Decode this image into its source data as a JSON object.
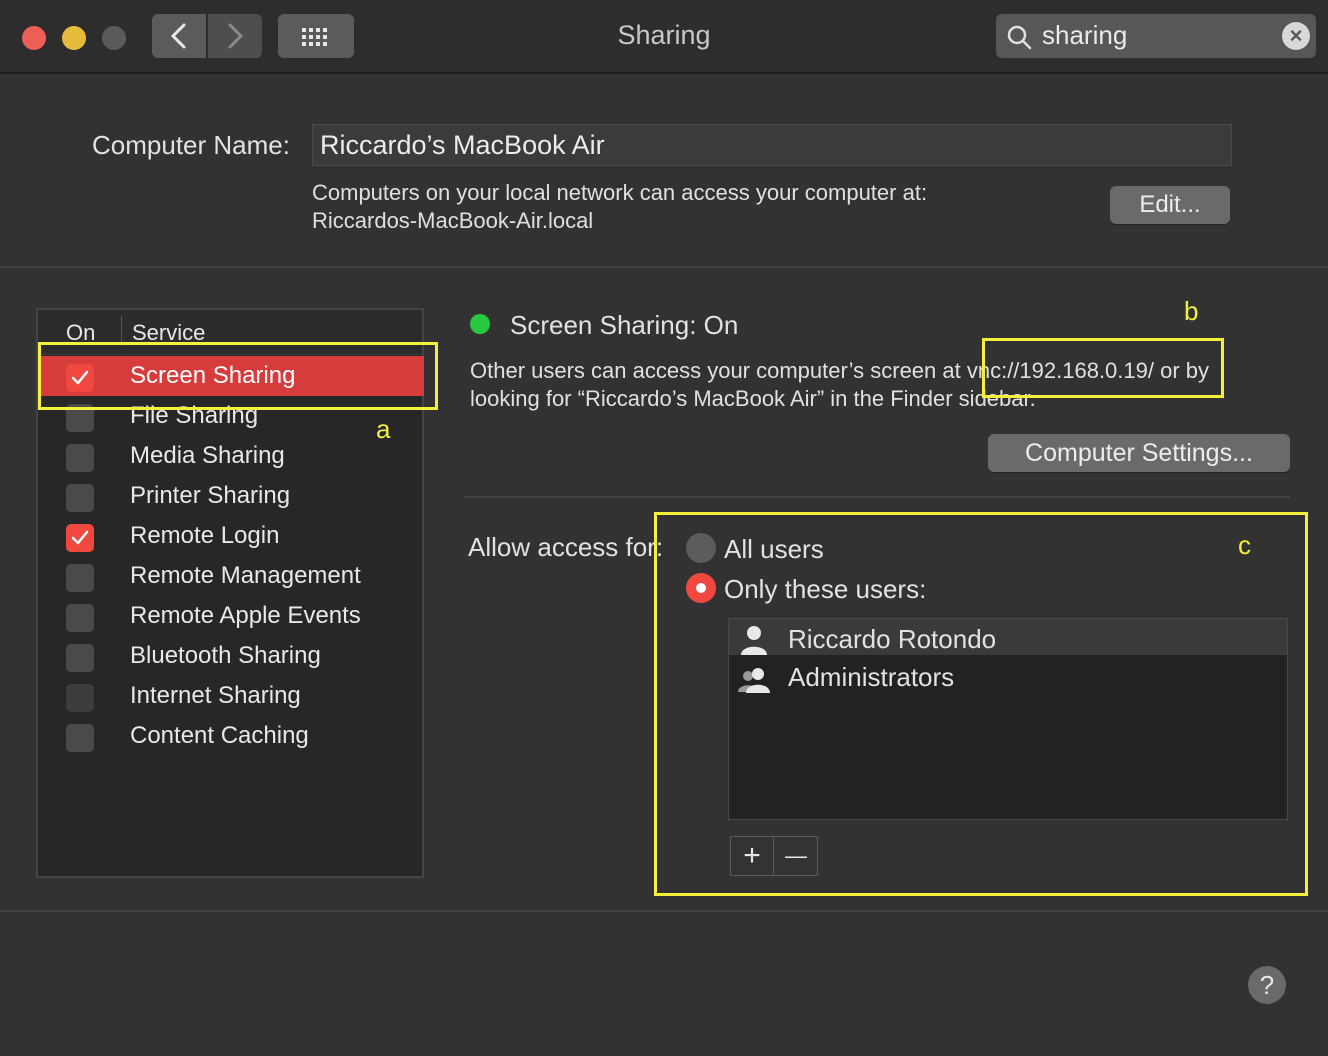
{
  "window": {
    "title": "Sharing",
    "search_value": "sharing"
  },
  "computer_name": {
    "label": "Computer Name:",
    "value": "Riccardo’s MacBook Air",
    "info_line1": "Computers on your local network can access your computer at:",
    "info_line2": "Riccardos-MacBook-Air.local",
    "edit_label": "Edit..."
  },
  "services": {
    "header_on": "On",
    "header_service": "Service",
    "items": [
      {
        "label": "Screen Sharing",
        "on": true,
        "selected": true
      },
      {
        "label": "File Sharing",
        "on": false
      },
      {
        "label": "Media Sharing",
        "on": false
      },
      {
        "label": "Printer Sharing",
        "on": false
      },
      {
        "label": "Remote Login",
        "on": true
      },
      {
        "label": "Remote Management",
        "on": false
      },
      {
        "label": "Remote Apple Events",
        "on": false
      },
      {
        "label": "Bluetooth Sharing",
        "on": false
      },
      {
        "label": "Internet Sharing",
        "on": false
      },
      {
        "label": "Content Caching",
        "on": false
      }
    ]
  },
  "detail": {
    "status": "Screen Sharing: On",
    "status_color": "#28c840",
    "desc_line1": "Other users can access your computer’s screen at vnc://192.168.0.19/ or by",
    "desc_line2": "looking for “Riccardo’s MacBook Air” in the Finder sidebar.",
    "settings_label": "Computer Settings...",
    "access_label": "Allow access for:",
    "option_all": "All users",
    "option_only": "Only these users:",
    "selected_option": "only",
    "users": [
      "Riccardo Rotondo",
      "Administrators"
    ],
    "add_label": "+",
    "remove_label": "—"
  },
  "annotations": {
    "a": "a",
    "b": "b",
    "c": "c",
    "color": "#f5f03a"
  },
  "help_label": "?",
  "colors": {
    "accent": "#f0483e",
    "selection": "#d63c3c"
  }
}
